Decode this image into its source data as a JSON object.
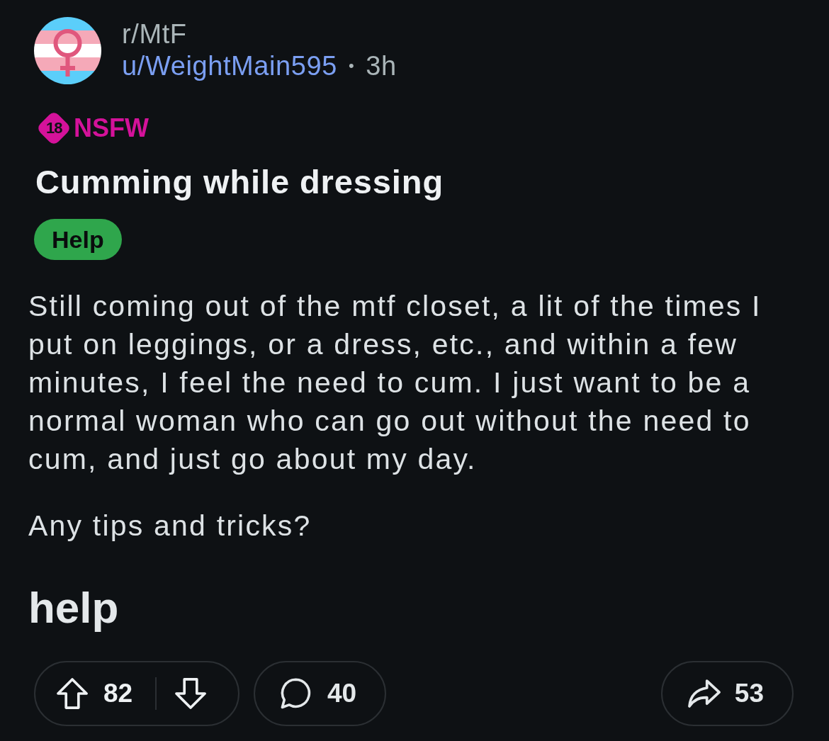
{
  "post": {
    "community": "r/MtF",
    "author": "u/WeightMain595",
    "separator": "•",
    "age": "3h",
    "nsfw": {
      "badge": "18",
      "label": "NSFW"
    },
    "title": "Cumming while dressing",
    "flair": "Help",
    "body": [
      {
        "kind": "paragraph",
        "text": "Still coming out of the mtf closet, a lit of the times I put on leggings, or a dress, etc., and within a few minutes, I feel the need to cum. I just want to be a normal woman who can go out without the need to cum, and just go about my day."
      },
      {
        "kind": "paragraph",
        "text": "Any tips and tricks?"
      },
      {
        "kind": "heading",
        "text": "help"
      }
    ]
  },
  "actions": [
    {
      "kind": "vote",
      "score": "82"
    },
    {
      "kind": "comments",
      "count": "40"
    },
    {
      "kind": "share",
      "count": "53"
    }
  ]
}
